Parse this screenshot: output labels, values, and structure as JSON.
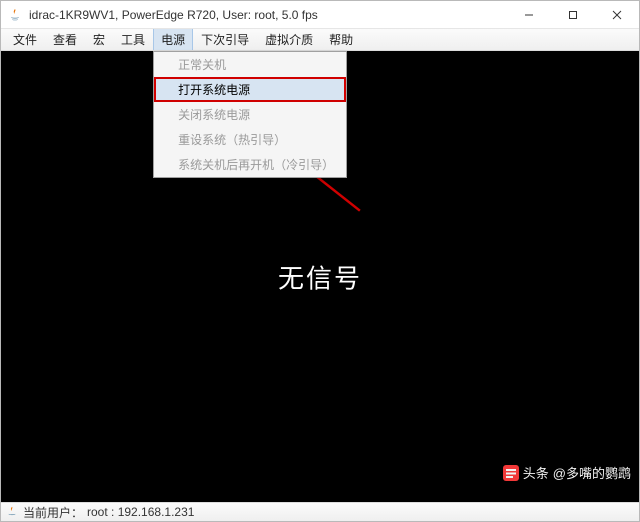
{
  "titlebar": {
    "title": "idrac-1KR9WV1, PowerEdge R720, User: root, 5.0 fps"
  },
  "menubar": {
    "items": [
      "文件",
      "查看",
      "宏",
      "工具",
      "电源",
      "下次引导",
      "虚拟介质",
      "帮助"
    ],
    "open_index": 4
  },
  "power_menu": {
    "items": [
      {
        "label": "正常关机",
        "enabled": false
      },
      {
        "label": "打开系统电源",
        "enabled": true,
        "highlight": true
      },
      {
        "label": "关闭系统电源",
        "enabled": false
      },
      {
        "label": "重设系统（热引导）",
        "enabled": false
      },
      {
        "label": "系统关机后再开机（冷引导）",
        "enabled": false
      }
    ]
  },
  "content": {
    "no_signal": "无信号"
  },
  "watermark": {
    "prefix": "头条",
    "at": "@多嘴的鹦鹉"
  },
  "statusbar": {
    "user_label": "当前用户：",
    "user_value": "root : 192.168.1.231"
  }
}
